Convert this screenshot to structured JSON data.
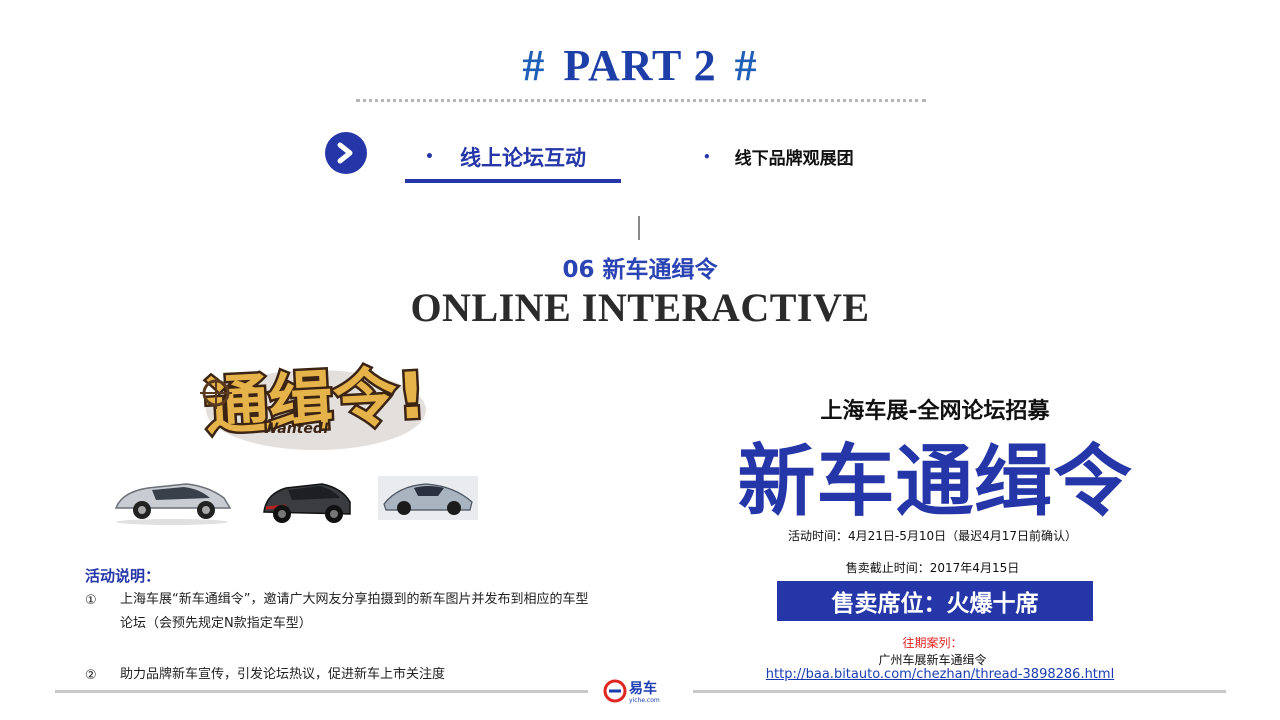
{
  "header": {
    "hash_left": "#",
    "part_label": "PART 2",
    "hash_right": "#"
  },
  "nav": {
    "arrow_icon": "chevron-right-circle-icon",
    "items": [
      {
        "bullet": "•",
        "label": "线上论坛互动",
        "active": true
      },
      {
        "bullet": "•",
        "label": "线下品牌观展团",
        "active": false
      }
    ]
  },
  "section": {
    "number_title": "06 新车通缉令",
    "english_title": "ONLINE INTERACTIVE"
  },
  "visuals": {
    "wanted_logo_text": "通缉令!",
    "wanted_logo_sub": "Wanted!"
  },
  "rules": {
    "heading": "活动说明：",
    "items": [
      {
        "num": "①",
        "text": "上海车展“新车通缉令”，邀请广大网友分享拍摄到的新车图片并发布到相应的车型论坛（会预先规定N款指定车型）"
      },
      {
        "num": "②",
        "text": "助力品牌新车宣传，引发论坛热议，促进新车上市关注度"
      }
    ]
  },
  "promo": {
    "subtitle": "上海车展-全网论坛招募",
    "title": "新车通缉令",
    "activity_time": "活动时间：4月21日-5月10日（最迟4月17日前确认）",
    "deadline": "售卖截止时间：2017年4月15日",
    "seats_banner": "售卖席位：火爆十席",
    "past_label": "往期案列：",
    "past_case_name": "广州车展新车通缉令",
    "past_case_link": "http://baa.bitauto.com/chezhan/thread-3898286.html"
  },
  "footer": {
    "logo_text": "易车",
    "logo_sub": "yiche.com"
  },
  "colors": {
    "accent": "#2436a8",
    "red": "#e0241f",
    "gray_line": "#c8c8c8"
  }
}
